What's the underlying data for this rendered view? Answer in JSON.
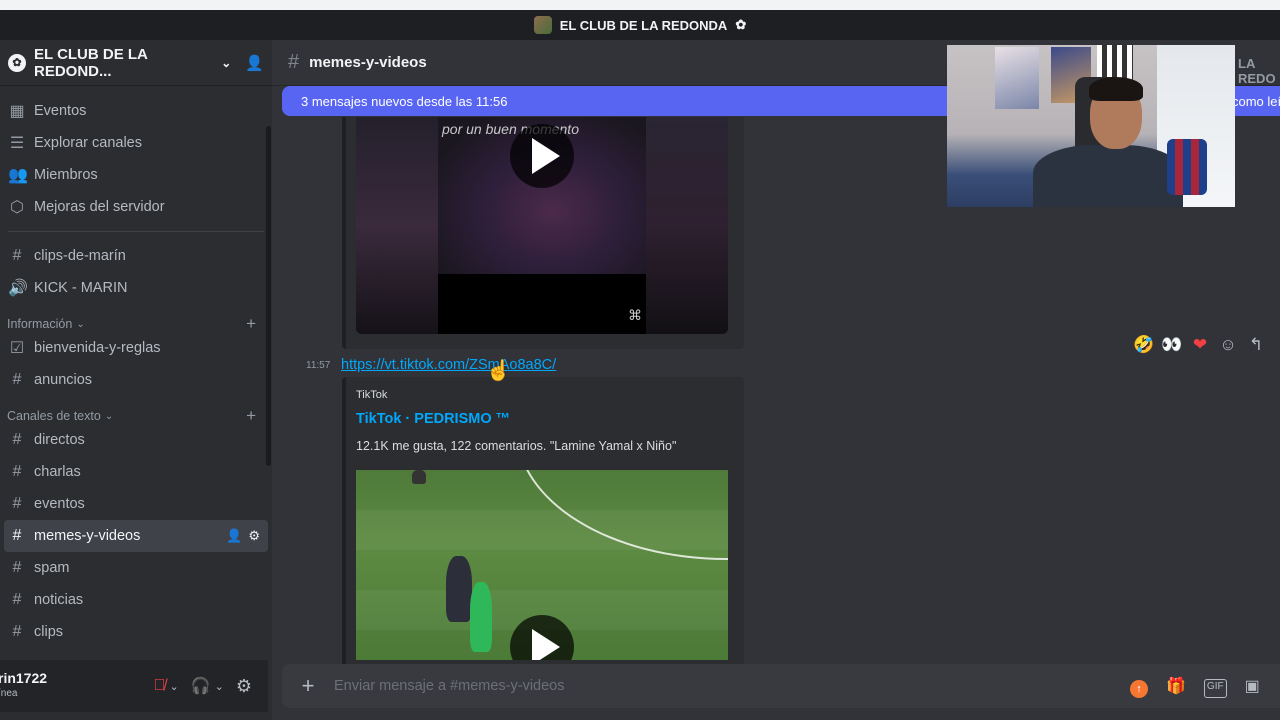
{
  "window": {
    "title": "EL CLUB DE LA REDONDA"
  },
  "server": {
    "name": "EL CLUB DE LA REDOND...",
    "header_right": "LA REDO"
  },
  "sidebar": {
    "top_items": [
      {
        "label": "Eventos",
        "icon": "calendar-icon"
      },
      {
        "label": "Explorar canales",
        "icon": "channels-list-icon"
      },
      {
        "label": "Miembros",
        "icon": "members-icon"
      },
      {
        "label": "Mejoras del servidor",
        "icon": "boost-icon"
      }
    ],
    "pinned_channels": [
      {
        "label": "clips-de-marín",
        "icon": "hash-icon"
      },
      {
        "label": "KICK - MARIN",
        "icon": "speaker-icon"
      }
    ],
    "categories": [
      {
        "name": "Información",
        "channels": [
          {
            "label": "bienvenida-y-reglas",
            "icon": "rules-icon"
          },
          {
            "label": "anuncios",
            "icon": "hash-icon"
          }
        ]
      },
      {
        "name": "Canales de texto",
        "channels": [
          {
            "label": "directos"
          },
          {
            "label": "charlas"
          },
          {
            "label": "eventos"
          },
          {
            "label": "memes-y-videos",
            "active": true
          },
          {
            "label": "spam"
          },
          {
            "label": "noticias"
          },
          {
            "label": "clips"
          }
        ]
      }
    ]
  },
  "user": {
    "name": "rin1722",
    "status": "ínea"
  },
  "channel": {
    "name": "memes-y-videos"
  },
  "banner": {
    "text": "3 mensajes nuevos desde las 11:56",
    "right": "como leí"
  },
  "video1": {
    "overlay_text": "por un buen momento"
  },
  "message": {
    "time": "11:57",
    "link": "https://vt.tiktok.com/ZSmAo8a8C/",
    "embed": {
      "provider": "TikTok",
      "title": "TikTok · PEDRISMO ™",
      "description": "12.1K me gusta, 122 comentarios. \"Lamine Yamal x Niño\""
    }
  },
  "reactions": [
    "rofl-emoji",
    "eyes-emoji",
    "heart-emoji",
    "add-reaction-icon",
    "reply-icon"
  ],
  "composer": {
    "placeholder": "Enviar mensaje a #memes-y-videos"
  },
  "colors": {
    "accent": "#5865f2",
    "link": "#00a8fc",
    "mute": "#f23f43"
  }
}
